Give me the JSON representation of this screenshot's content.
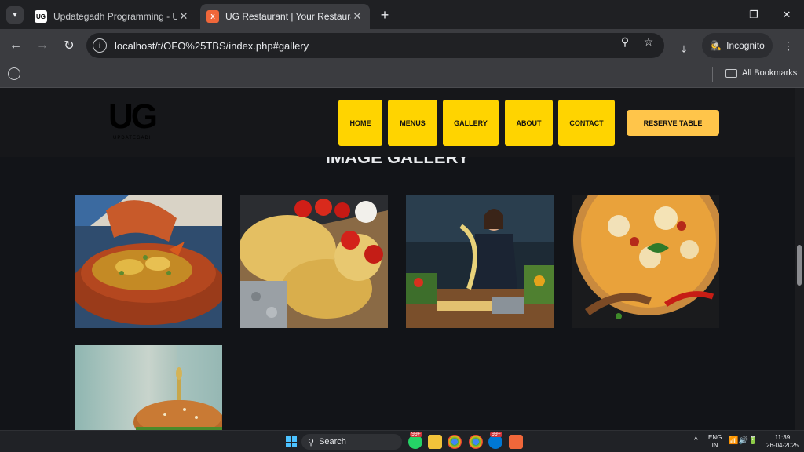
{
  "browser": {
    "tabs": [
      {
        "title": "Updategadh Programming - Upda",
        "favicon": "UG",
        "active": false
      },
      {
        "title": "UG Restaurant | Your Restaurant",
        "favicon": "X",
        "active": true
      }
    ],
    "url": "localhost/t/OFO%25TBS/index.php#gallery",
    "incognito_label": "Incognito",
    "bookmarks_all": "All Bookmarks"
  },
  "site": {
    "logo_text": "UG",
    "logo_sub": "UPDATEGADH",
    "nav": [
      "HOME",
      "MENUS",
      "GALLERY",
      "ABOUT",
      "CONTACT"
    ],
    "reserve": "RESERVE TABLE",
    "gallery_title": "IMAGE GALLERY",
    "gallery_images": [
      "tagine-dish",
      "fresh-pasta-tomatoes",
      "chef-making-pasta",
      "pizza-spices",
      "burger"
    ]
  },
  "taskbar": {
    "search": "Search",
    "badge1": "99+",
    "badge2": "99+",
    "lang_top": "ENG",
    "lang_bottom": "IN",
    "time": "11:39",
    "date": "26-04-2025"
  },
  "colors": {
    "nav_button": "#ffd400",
    "reserve_button": "#ffc54a",
    "page_bg": "#121418"
  }
}
